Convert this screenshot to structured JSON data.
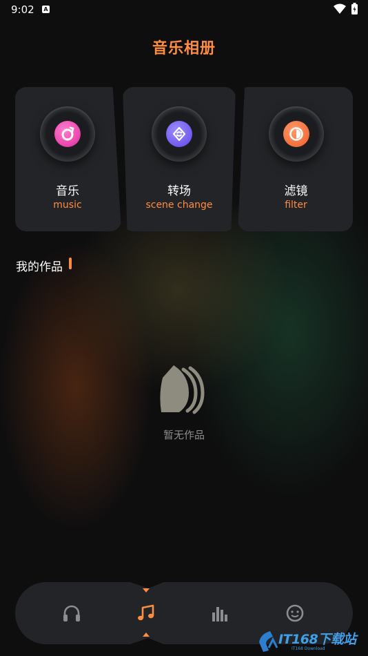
{
  "status": {
    "time": "9:02",
    "notification_letter": "A"
  },
  "app": {
    "title": "音乐相册"
  },
  "features": [
    {
      "label": "音乐",
      "sub": "music",
      "icon": "music-disc-icon",
      "color": "#e0299b"
    },
    {
      "label": "转场",
      "sub": "scene change",
      "icon": "refresh-icon",
      "color": "#5e46e8"
    },
    {
      "label": "滤镜",
      "sub": "filter",
      "icon": "filter-icon",
      "color": "#ee5c26"
    }
  ],
  "works": {
    "title": "我的作品",
    "empty_text": "暂无作品"
  },
  "tabs": [
    {
      "name": "listen",
      "icon": "headphones-icon",
      "active": false
    },
    {
      "name": "music",
      "icon": "music-note-icon",
      "active": true
    },
    {
      "name": "stats",
      "icon": "bar-chart-icon",
      "active": false
    },
    {
      "name": "profile",
      "icon": "face-icon",
      "active": false
    }
  ],
  "watermark": {
    "text": "IT168下载站",
    "sub": "IT168 Download"
  },
  "colors": {
    "accent": "#ff8d3f",
    "card": "#232427",
    "background": "#0e0e0f"
  }
}
